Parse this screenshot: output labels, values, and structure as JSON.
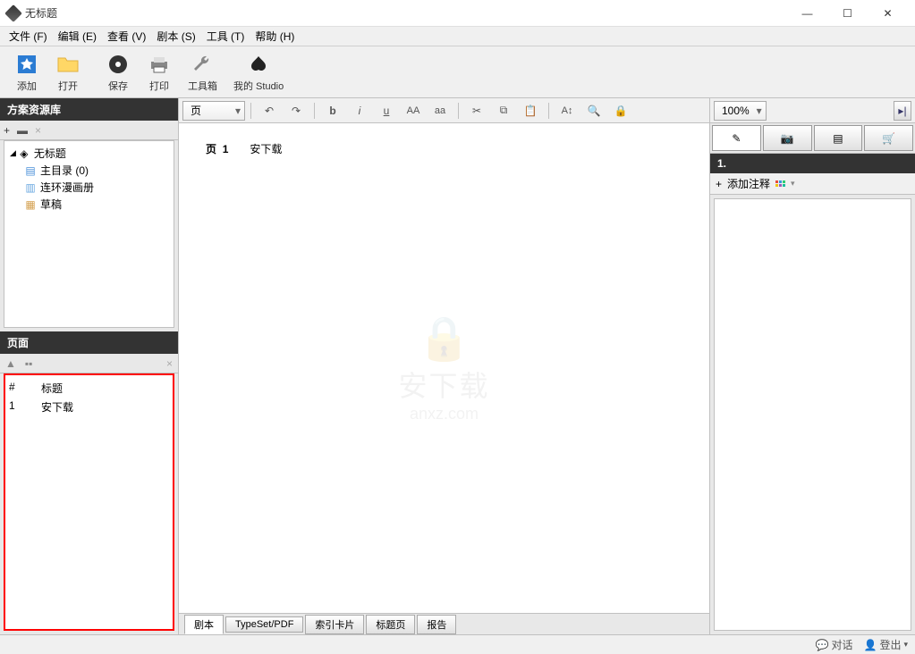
{
  "window": {
    "title": "无标题"
  },
  "menu": {
    "file": "文件 (F)",
    "edit": "编辑 (E)",
    "view": "查看 (V)",
    "script": "剧本 (S)",
    "tools": "工具 (T)",
    "help": "帮助 (H)"
  },
  "toolbar": {
    "add": "添加",
    "open": "打开",
    "save": "保存",
    "print": "打印",
    "toolbox": "工具箱",
    "my_studio": "我的 Studio"
  },
  "left": {
    "resource_header": "方案资源库",
    "tree": {
      "root": "无标题",
      "main_catalog": "主目录 (0)",
      "comic_album": "连环漫画册",
      "draft": "草稿"
    },
    "pages_header": "页面",
    "pages_cols": {
      "num": "#",
      "title": "标题"
    },
    "pages_rows": [
      {
        "num": "1",
        "title": "安下载"
      }
    ]
  },
  "format": {
    "style_select": "页"
  },
  "editor": {
    "page_label": "页",
    "page_num": "1",
    "content": "安下载",
    "watermark_text": "安下载",
    "watermark_url": "anxz.com"
  },
  "bottom_tabs": {
    "script": "剧本",
    "typeset": "TypeSet/PDF",
    "index_cards": "索引卡片",
    "title_page": "标题页",
    "report": "报告"
  },
  "right": {
    "zoom": "100%",
    "section_num": "1.",
    "add_annotation": "添加注释"
  },
  "status": {
    "chat": "对话",
    "logout": "登出"
  }
}
